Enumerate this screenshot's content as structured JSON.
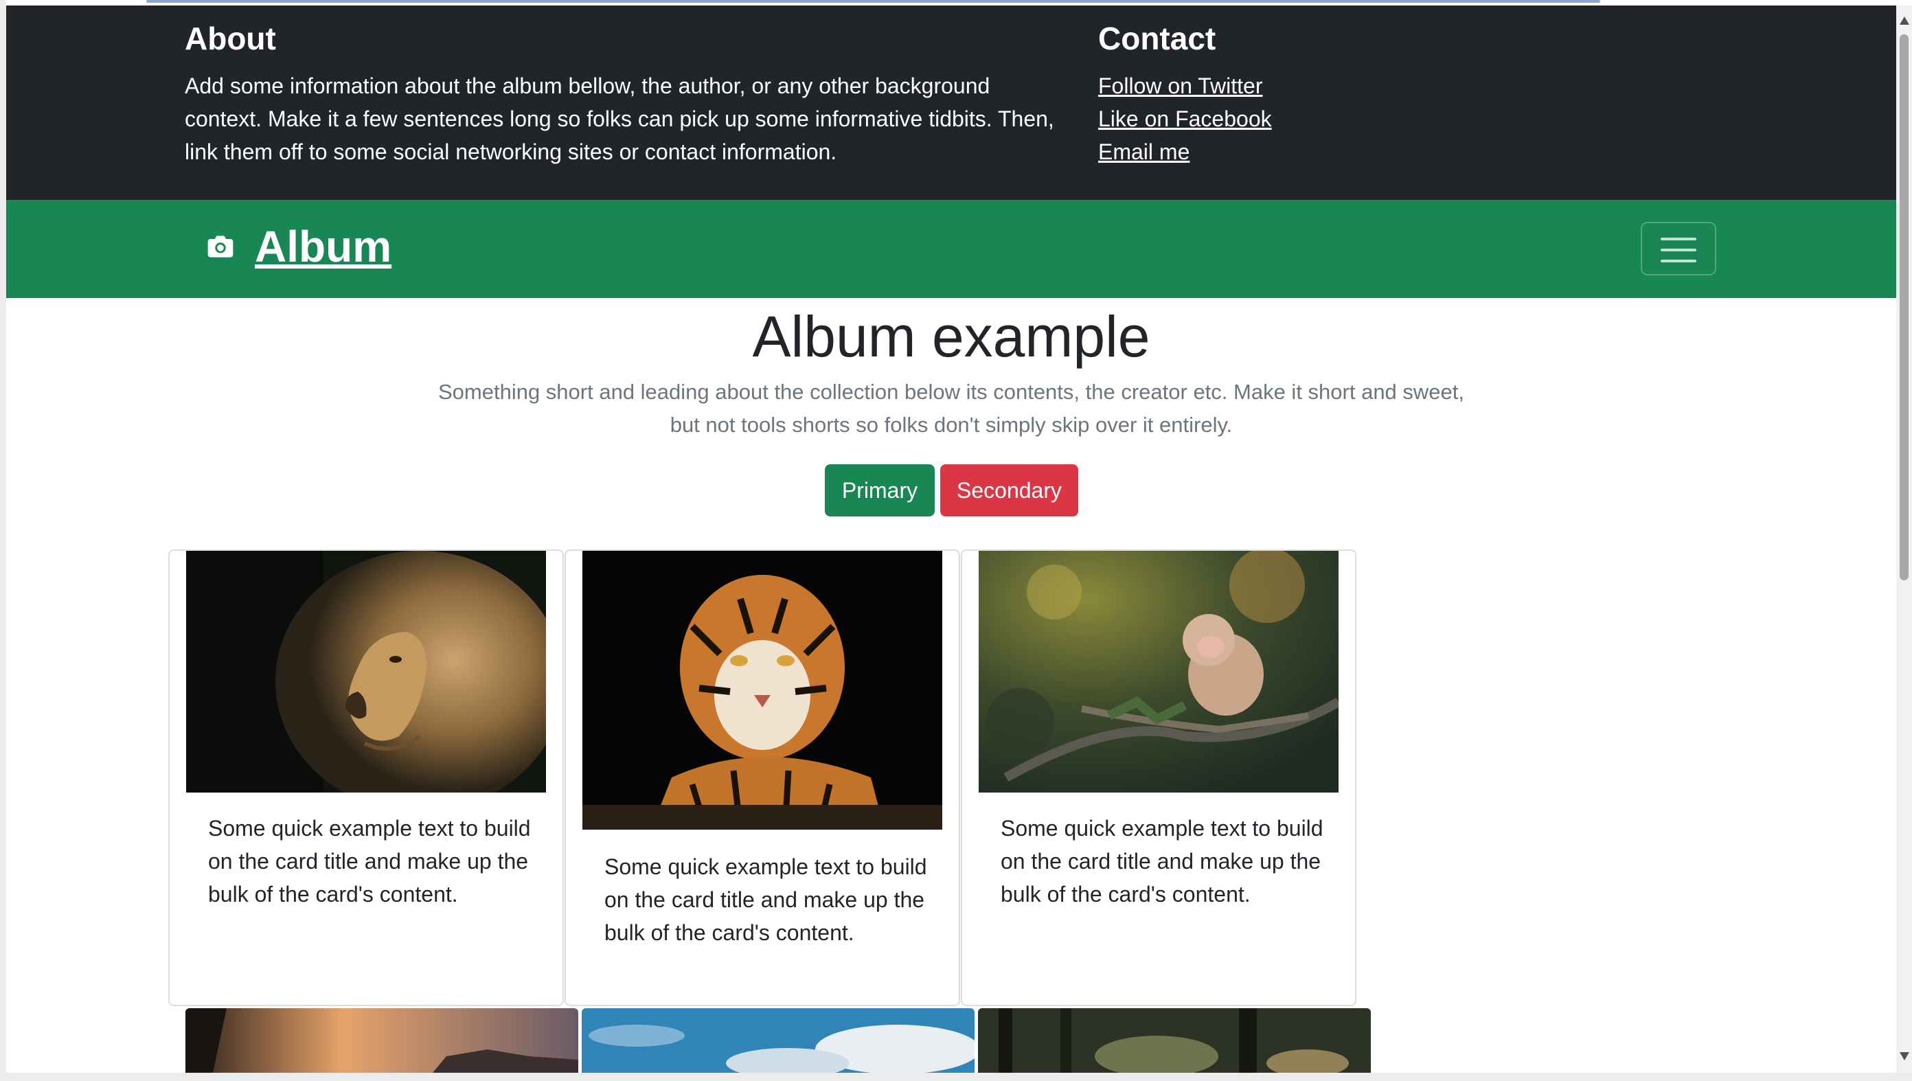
{
  "header": {
    "about_title": "About",
    "about_text": "Add some information about the album bellow, the author, or any other background context. Make it a few sentences long so folks can pick up some informative tidbits. Then, link them off to some social networking sites or contact information.",
    "contact_title": "Contact",
    "links": [
      "Follow on Twitter",
      "Like on Facebook",
      "Email me"
    ]
  },
  "navbar": {
    "brand": "Album",
    "brand_icon": "camera-icon",
    "toggler_icon": "hamburger-icon"
  },
  "hero": {
    "title": "Album example",
    "lead": "Something short and leading about the collection below its contents, the creator etc. Make it short and sweet, but not tools shorts so folks don't simply skip over it entirely.",
    "primary_label": "Primary",
    "secondary_label": "Secondary"
  },
  "cards": [
    {
      "image": "lion photo",
      "text": "Some quick example text to build on the card title and make up the bulk of the card's content."
    },
    {
      "image": "tiger photo",
      "text": "Some quick example text to build on the card title and make up the bulk of the card's content."
    },
    {
      "image": "baby monkey on branch photo",
      "text": "Some quick example text to build on the card title and make up the bulk of the card's content."
    }
  ],
  "colors": {
    "dark": "#212529",
    "success": "#198754",
    "danger": "#dc3545"
  }
}
